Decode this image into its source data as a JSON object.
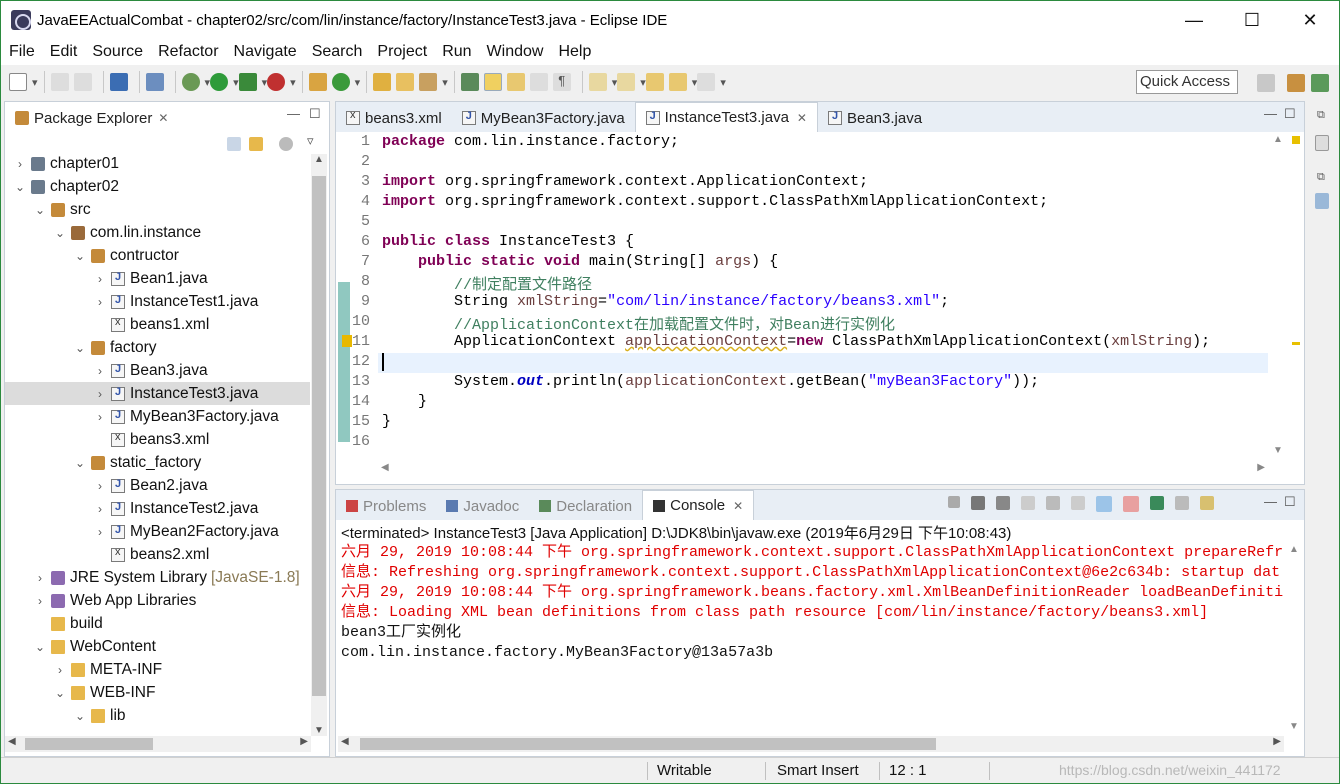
{
  "window": {
    "title": "JavaEEActualCombat - chapter02/src/com/lin/instance/factory/InstanceTest3.java - Eclipse IDE"
  },
  "menu": [
    "File",
    "Edit",
    "Source",
    "Refactor",
    "Navigate",
    "Search",
    "Project",
    "Run",
    "Window",
    "Help"
  ],
  "quick_access": "Quick Access",
  "package_explorer": {
    "tab_label": "Package Explorer",
    "tree": [
      {
        "label": "chapter01",
        "depth": 0,
        "chev": ">",
        "icon": "proj"
      },
      {
        "label": "chapter02",
        "depth": 0,
        "chev": "v",
        "icon": "proj"
      },
      {
        "label": "src",
        "depth": 1,
        "chev": "v",
        "icon": "pkg"
      },
      {
        "label": "com.lin.instance",
        "depth": 2,
        "chev": "v",
        "icon": "pkgexp"
      },
      {
        "label": "contructor",
        "depth": 3,
        "chev": "v",
        "icon": "pkg"
      },
      {
        "label": "Bean1.java",
        "depth": 4,
        "chev": ">",
        "icon": "java"
      },
      {
        "label": "InstanceTest1.java",
        "depth": 4,
        "chev": ">",
        "icon": "java"
      },
      {
        "label": "beans1.xml",
        "depth": 4,
        "chev": "",
        "icon": "xml"
      },
      {
        "label": "factory",
        "depth": 3,
        "chev": "v",
        "icon": "pkg"
      },
      {
        "label": "Bean3.java",
        "depth": 4,
        "chev": ">",
        "icon": "java"
      },
      {
        "label": "InstanceTest3.java",
        "depth": 4,
        "chev": ">",
        "icon": "java",
        "selected": true
      },
      {
        "label": "MyBean3Factory.java",
        "depth": 4,
        "chev": ">",
        "icon": "java"
      },
      {
        "label": "beans3.xml",
        "depth": 4,
        "chev": "",
        "icon": "xml"
      },
      {
        "label": "static_factory",
        "depth": 3,
        "chev": "v",
        "icon": "pkg"
      },
      {
        "label": "Bean2.java",
        "depth": 4,
        "chev": ">",
        "icon": "java"
      },
      {
        "label": "InstanceTest2.java",
        "depth": 4,
        "chev": ">",
        "icon": "java"
      },
      {
        "label": "MyBean2Factory.java",
        "depth": 4,
        "chev": ">",
        "icon": "java"
      },
      {
        "label": "beans2.xml",
        "depth": 4,
        "chev": "",
        "icon": "xml"
      },
      {
        "label": "JRE System Library",
        "suffix": "[JavaSE-1.8]",
        "depth": 1,
        "chev": ">",
        "icon": "lib"
      },
      {
        "label": "Web App Libraries",
        "depth": 1,
        "chev": ">",
        "icon": "lib"
      },
      {
        "label": "build",
        "depth": 1,
        "chev": "",
        "icon": "folder"
      },
      {
        "label": "WebContent",
        "depth": 1,
        "chev": "v",
        "icon": "folder"
      },
      {
        "label": "META-INF",
        "depth": 2,
        "chev": ">",
        "icon": "folder"
      },
      {
        "label": "WEB-INF",
        "depth": 2,
        "chev": "v",
        "icon": "folder"
      },
      {
        "label": "lib",
        "depth": 3,
        "chev": "v",
        "icon": "folder"
      }
    ]
  },
  "editor": {
    "tabs": [
      {
        "label": "beans3.xml",
        "icon": "xml"
      },
      {
        "label": "MyBean3Factory.java",
        "icon": "java"
      },
      {
        "label": "InstanceTest3.java",
        "icon": "java",
        "active": true
      },
      {
        "label": "Bean3.java",
        "icon": "java"
      }
    ],
    "lines": [
      "1",
      "2",
      "3",
      "4",
      "5",
      "6",
      "7",
      "8",
      "9",
      "10",
      "11",
      "12",
      "13",
      "14",
      "15",
      "16"
    ],
    "code": {
      "l1a": "package",
      "l1b": " com.lin.instance.factory;",
      "l3a": "import",
      "l3b": " org.springframework.context.ApplicationContext;",
      "l4a": "import",
      "l4b": " org.springframework.context.support.ClassPathXmlApplicationContext;",
      "l6a": "public class",
      "l6b": " InstanceTest3 {",
      "l7a": "    public static void",
      "l7b": " main(String[] ",
      "l7c": "args",
      "l7d": ") {",
      "l8": "        //制定配置文件路径",
      "l9a": "        String ",
      "l9b": "xmlString",
      "l9c": "=",
      "l9d": "\"com/lin/instance/factory/beans3.xml\"",
      "l9e": ";",
      "l10": "        //ApplicationContext在加载配置文件时，对Bean进行实例化",
      "l11a": "        ApplicationContext ",
      "l11b": "applicationContext",
      "l11c": "=",
      "l11d": "new",
      "l11e": " ClassPathXmlApplicationContext(",
      "l11f": "xmlString",
      "l11g": ");",
      "l13a": "        System.",
      "l13b": "out",
      "l13c": ".println(",
      "l13d": "applicationContext",
      "l13e": ".getBean(",
      "l13f": "\"myBean3Factory\"",
      "l13g": "));",
      "l14": "    }",
      "l15": "}"
    }
  },
  "console": {
    "tabs": [
      "Problems",
      "Javadoc",
      "Declaration",
      "Console"
    ],
    "terminated": "<terminated> InstanceTest3 [Java Application] D:\\JDK8\\bin\\javaw.exe (2019年6月29日 下午10:08:43)",
    "lines": [
      {
        "text": "六月 29, 2019 10:08:44 下午 org.springframework.context.support.ClassPathXmlApplicationContext prepareRefr",
        "red": true
      },
      {
        "text": "信息: Refreshing org.springframework.context.support.ClassPathXmlApplicationContext@6e2c634b: startup dat",
        "red": true
      },
      {
        "text": "六月 29, 2019 10:08:44 下午 org.springframework.beans.factory.xml.XmlBeanDefinitionReader loadBeanDefiniti",
        "red": true
      },
      {
        "text": "信息: Loading XML bean definitions from class path resource [com/lin/instance/factory/beans3.xml]",
        "red": true
      },
      {
        "text": "bean3工厂实例化",
        "red": false
      },
      {
        "text": "com.lin.instance.factory.MyBean3Factory@13a57a3b",
        "red": false
      }
    ]
  },
  "status": {
    "writable": "Writable",
    "insert": "Smart Insert",
    "position": "12 : 1",
    "watermark": "https://blog.csdn.net/weixin_441172"
  }
}
